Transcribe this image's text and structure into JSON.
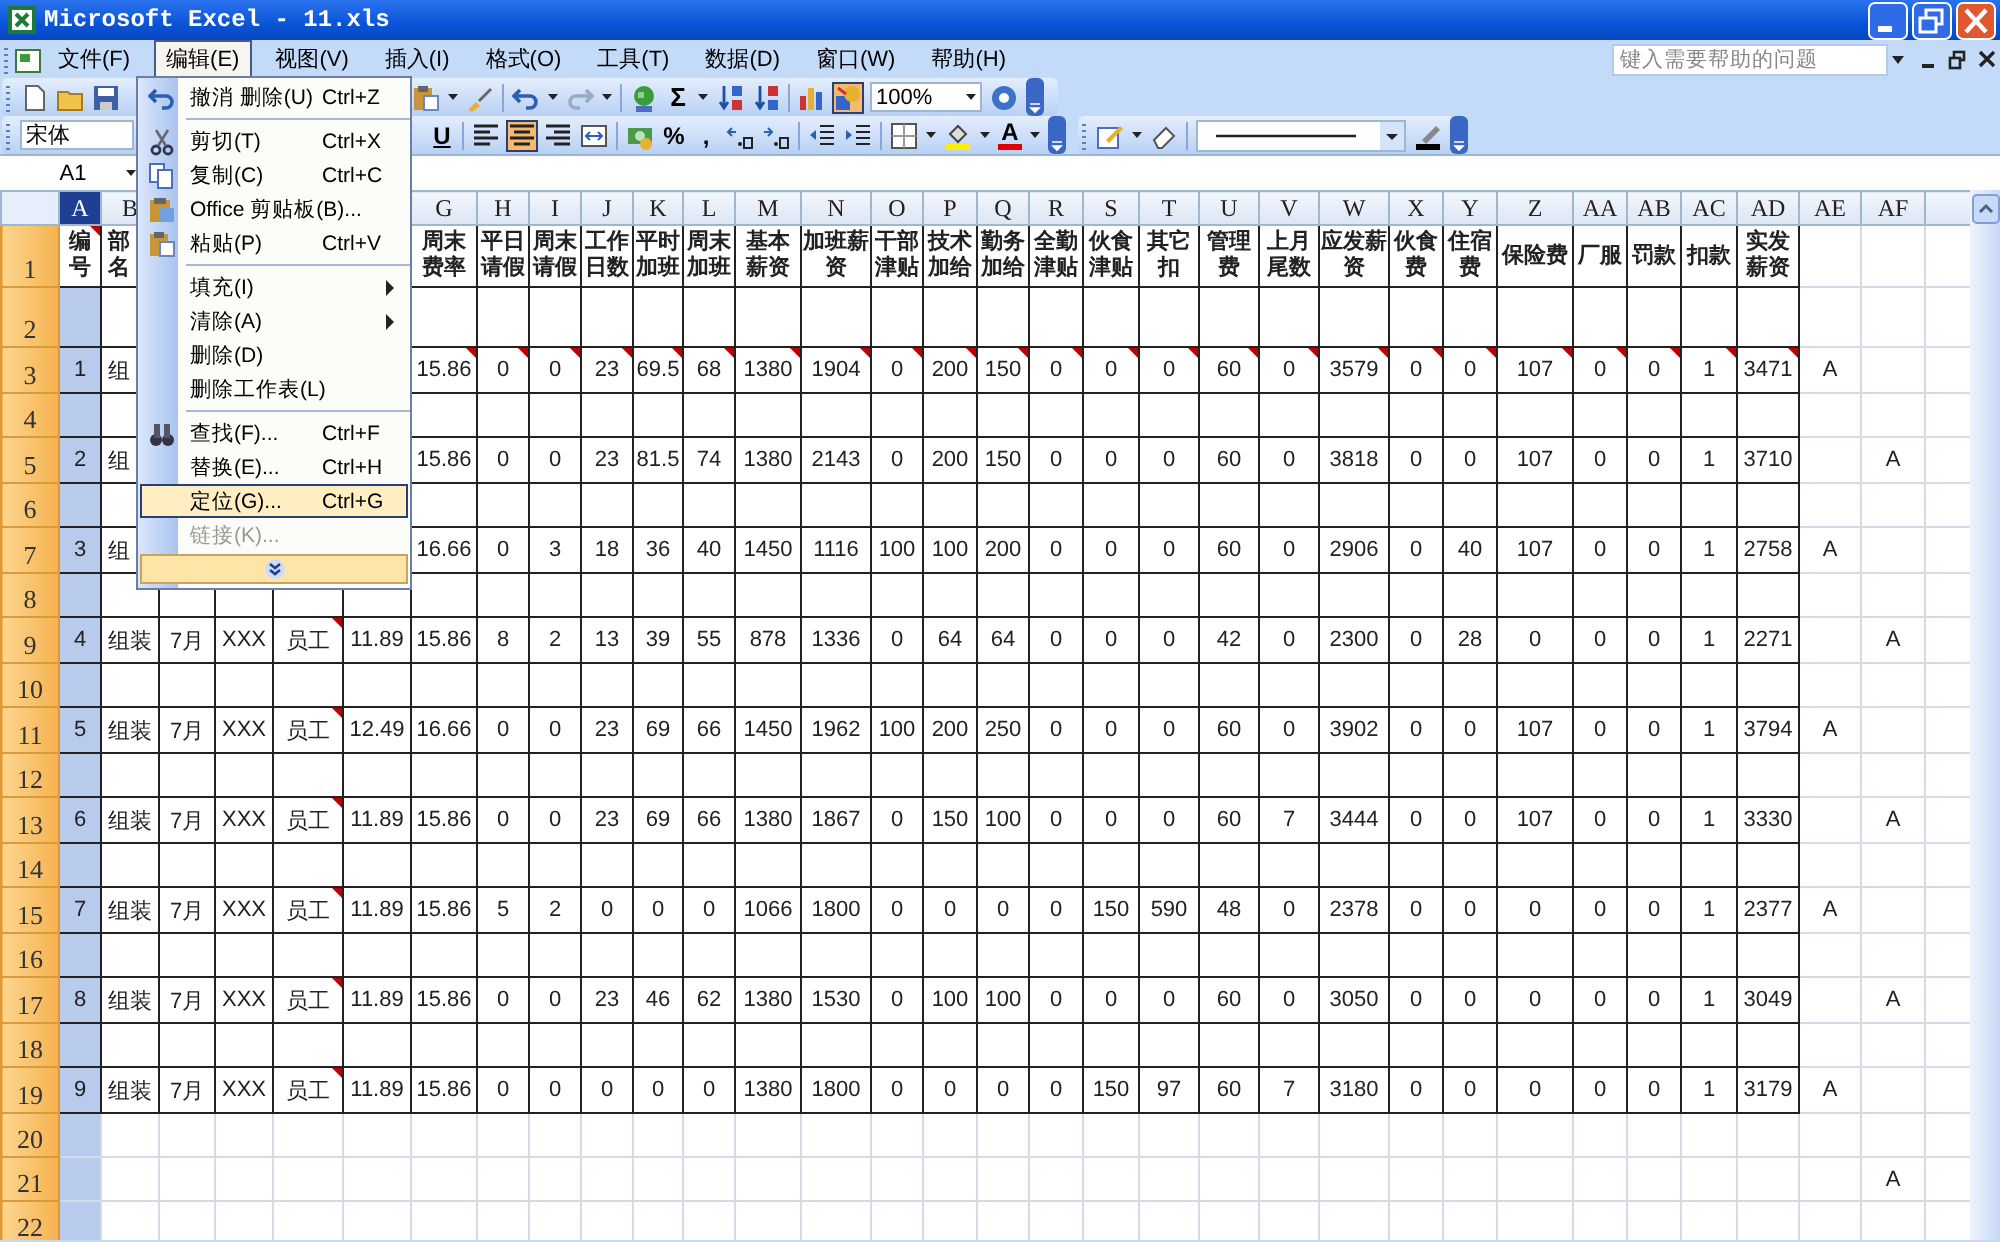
{
  "window": {
    "title": "Microsoft Excel - 11.xls"
  },
  "menu_bar": {
    "items": [
      {
        "label": "文件(F)",
        "selected": false
      },
      {
        "label": "编辑(E)",
        "selected": true
      },
      {
        "label": "视图(V)",
        "selected": false
      },
      {
        "label": "插入(I)",
        "selected": false
      },
      {
        "label": "格式(O)",
        "selected": false
      },
      {
        "label": "工具(T)",
        "selected": false
      },
      {
        "label": "数据(D)",
        "selected": false
      },
      {
        "label": "窗口(W)",
        "selected": false
      },
      {
        "label": "帮助(H)",
        "selected": false
      }
    ],
    "help_field": {
      "placeholder": "键入需要帮助的问题"
    }
  },
  "standard_toolbar": {
    "sum_symbol": "Σ",
    "zoom": "100%"
  },
  "formatting_toolbar": {
    "font": "宋体",
    "underline": "U",
    "percent": "%",
    "comma": ",",
    "font_color_letter": "A"
  },
  "formula_bar": {
    "name_box": "A1"
  },
  "edit_menu": {
    "items": [
      {
        "kind": "item",
        "label": "撤消 删除(U)",
        "shortcut": "Ctrl+Z",
        "selected": false,
        "disabled": false
      },
      {
        "kind": "separator"
      },
      {
        "kind": "item",
        "label": "剪切(T)",
        "shortcut": "Ctrl+X",
        "selected": false,
        "disabled": false
      },
      {
        "kind": "item",
        "label": "复制(C)",
        "shortcut": "Ctrl+C",
        "selected": false,
        "disabled": false
      },
      {
        "kind": "item",
        "label": "Office 剪贴板(B)...",
        "selected": false,
        "disabled": false
      },
      {
        "kind": "item",
        "label": "粘贴(P)",
        "shortcut": "Ctrl+V",
        "selected": false,
        "disabled": false
      },
      {
        "kind": "separator"
      },
      {
        "kind": "submenu",
        "label": "填充(I)",
        "selected": false,
        "disabled": false
      },
      {
        "kind": "submenu",
        "label": "清除(A)",
        "selected": false,
        "disabled": false
      },
      {
        "kind": "item",
        "label": "删除(D)",
        "selected": false,
        "disabled": false
      },
      {
        "kind": "item",
        "label": "删除工作表(L)",
        "selected": false,
        "disabled": false
      },
      {
        "kind": "separator"
      },
      {
        "kind": "item",
        "label": "查找(F)...",
        "shortcut": "Ctrl+F",
        "selected": false,
        "disabled": false
      },
      {
        "kind": "item",
        "label": "替换(E)...",
        "shortcut": "Ctrl+H",
        "selected": false,
        "disabled": false
      },
      {
        "kind": "item",
        "label": "定位(G)...",
        "shortcut": "Ctrl+G",
        "selected": true,
        "disabled": false
      },
      {
        "kind": "item",
        "label": "链接(K)...",
        "selected": false,
        "disabled": true
      },
      {
        "kind": "expand"
      }
    ]
  },
  "grid": {
    "columns": [
      {
        "letter": "A",
        "selected": true
      },
      {
        "letter": "B",
        "selected": false
      },
      null,
      null,
      null,
      null,
      {
        "letter": "G",
        "selected": false
      },
      {
        "letter": "H",
        "selected": false
      },
      {
        "letter": "I",
        "selected": false
      },
      {
        "letter": "J",
        "selected": false
      },
      {
        "letter": "K",
        "selected": false
      },
      {
        "letter": "L",
        "selected": false
      },
      {
        "letter": "M",
        "selected": false
      },
      {
        "letter": "N",
        "selected": false
      },
      {
        "letter": "O",
        "selected": false
      },
      {
        "letter": "P",
        "selected": false
      },
      {
        "letter": "Q",
        "selected": false
      },
      {
        "letter": "R",
        "selected": false
      },
      {
        "letter": "S",
        "selected": false
      },
      {
        "letter": "T",
        "selected": false
      },
      {
        "letter": "U",
        "selected": false
      },
      {
        "letter": "V",
        "selected": false
      },
      {
        "letter": "W",
        "selected": false
      },
      {
        "letter": "X",
        "selected": false
      },
      {
        "letter": "Y",
        "selected": false
      },
      {
        "letter": "Z",
        "selected": false
      },
      {
        "letter": "AA",
        "selected": false
      },
      {
        "letter": "AB",
        "selected": false
      },
      {
        "letter": "AC",
        "selected": false
      },
      {
        "letter": "AD",
        "selected": false
      },
      {
        "letter": "AE",
        "selected": false
      },
      {
        "letter": "AF",
        "selected": false
      }
    ],
    "rows": [
      {
        "number": "1",
        "cells": [
          {
            "text": "编号",
            "comment": true
          },
          "部名",
          null,
          null,
          null,
          null,
          "周末费率",
          "平日请假",
          "周末请假",
          "工作日数",
          "平时加班",
          "周末加班",
          "基本薪资",
          "加班薪资",
          "干部津贴",
          "技术加给",
          "勤务加给",
          "全勤津贴",
          "伙食津贴",
          "其它扣",
          "管理费",
          "上月尾数",
          "应发薪资",
          "伙食费",
          "住宿费",
          "保险费",
          "厂服",
          "罚款",
          "扣款",
          "实发薪资"
        ]
      },
      {
        "number": "2",
        "cells": []
      },
      {
        "number": "3",
        "cells": [
          "1",
          "组",
          null,
          null,
          null,
          null,
          {
            "text": "15.86",
            "comment": true
          },
          {
            "text": "0",
            "comment": true
          },
          {
            "text": "0",
            "comment": true
          },
          {
            "text": "23",
            "comment": true
          },
          {
            "text": "69.5",
            "comment": true
          },
          {
            "text": "68",
            "comment": true
          },
          {
            "text": "1380",
            "comment": true
          },
          {
            "text": "1904",
            "comment": true
          },
          {
            "text": "0",
            "comment": true
          },
          {
            "text": "200",
            "comment": true
          },
          {
            "text": "150",
            "comment": true
          },
          {
            "text": "0",
            "comment": true
          },
          {
            "text": "0",
            "comment": true
          },
          {
            "text": "0",
            "comment": true
          },
          {
            "text": "60",
            "comment": true
          },
          {
            "text": "0",
            "comment": true
          },
          {
            "text": "3579",
            "comment": true
          },
          {
            "text": "0",
            "comment": true
          },
          {
            "text": "0",
            "comment": true
          },
          {
            "text": "107",
            "comment": true
          },
          {
            "text": "0",
            "comment": true
          },
          {
            "text": "0",
            "comment": true
          },
          {
            "text": "1",
            "comment": true
          },
          {
            "text": "3471",
            "comment": true
          },
          "A"
        ]
      },
      {
        "number": "4",
        "cells": []
      },
      {
        "number": "5",
        "cells": [
          "2",
          "组",
          null,
          null,
          null,
          null,
          "15.86",
          "0",
          "0",
          "23",
          "81.5",
          "74",
          "1380",
          "2143",
          "0",
          "200",
          "150",
          "0",
          "0",
          "0",
          "60",
          "0",
          "3818",
          "0",
          "0",
          "107",
          "0",
          "0",
          "1",
          "3710",
          null,
          "A"
        ]
      },
      {
        "number": "6",
        "cells": []
      },
      {
        "number": "7",
        "cells": [
          "3",
          "组",
          null,
          null,
          null,
          null,
          "16.66",
          "0",
          "3",
          "18",
          "36",
          "40",
          "1450",
          "1116",
          "100",
          "100",
          "200",
          "0",
          "0",
          "0",
          "60",
          "0",
          "2906",
          "0",
          "40",
          "107",
          "0",
          "0",
          "1",
          "2758",
          "A"
        ]
      },
      {
        "number": "8",
        "cells": []
      },
      {
        "number": "9",
        "cells": [
          "4",
          "组装",
          "7月",
          "XXX",
          {
            "text": "员工",
            "comment": true
          },
          "11.89",
          "15.86",
          "8",
          "2",
          "13",
          "39",
          "55",
          "878",
          "1336",
          "0",
          "64",
          "64",
          "0",
          "0",
          "0",
          "42",
          "0",
          "2300",
          "0",
          "28",
          "0",
          "0",
          "0",
          "1",
          "2271",
          null,
          "A"
        ]
      },
      {
        "number": "10",
        "cells": []
      },
      {
        "number": "11",
        "cells": [
          "5",
          "组装",
          "7月",
          "XXX",
          {
            "text": "员工",
            "comment": true
          },
          "12.49",
          "16.66",
          "0",
          "0",
          "23",
          "69",
          "66",
          "1450",
          "1962",
          "100",
          "200",
          "250",
          "0",
          "0",
          "0",
          "60",
          "0",
          "3902",
          "0",
          "0",
          "107",
          "0",
          "0",
          "1",
          "3794",
          "A"
        ]
      },
      {
        "number": "12",
        "cells": []
      },
      {
        "number": "13",
        "cells": [
          "6",
          "组装",
          "7月",
          "XXX",
          {
            "text": "员工",
            "comment": true
          },
          "11.89",
          "15.86",
          "0",
          "0",
          "23",
          "69",
          "66",
          "1380",
          "1867",
          "0",
          "150",
          "100",
          "0",
          "0",
          "0",
          "60",
          "7",
          "3444",
          "0",
          "0",
          "107",
          "0",
          "0",
          "1",
          "3330",
          null,
          "A"
        ]
      },
      {
        "number": "14",
        "cells": []
      },
      {
        "number": "15",
        "cells": [
          "7",
          "组装",
          "7月",
          "XXX",
          {
            "text": "员工",
            "comment": true
          },
          "11.89",
          "15.86",
          "5",
          "2",
          "0",
          "0",
          "0",
          "1066",
          "1800",
          "0",
          "0",
          "0",
          "0",
          "150",
          "590",
          "48",
          "0",
          "2378",
          "0",
          "0",
          "0",
          "0",
          "0",
          "1",
          "2377",
          "A"
        ]
      },
      {
        "number": "16",
        "cells": []
      },
      {
        "number": "17",
        "cells": [
          "8",
          "组装",
          "7月",
          "XXX",
          {
            "text": "员工",
            "comment": true
          },
          "11.89",
          "15.86",
          "0",
          "0",
          "23",
          "46",
          "62",
          "1380",
          "1530",
          "0",
          "100",
          "100",
          "0",
          "0",
          "0",
          "60",
          "0",
          "3050",
          "0",
          "0",
          "0",
          "0",
          "0",
          "1",
          "3049",
          null,
          "A"
        ]
      },
      {
        "number": "18",
        "cells": []
      },
      {
        "number": "19",
        "cells": [
          "9",
          "组装",
          "7月",
          "XXX",
          {
            "text": "员工",
            "comment": true
          },
          "11.89",
          "15.86",
          "0",
          "0",
          "0",
          "0",
          "0",
          "1380",
          "1800",
          "0",
          "0",
          "0",
          "0",
          "150",
          "97",
          "60",
          "7",
          "3180",
          "0",
          "0",
          "0",
          "0",
          "0",
          "1",
          "3179",
          "A"
        ]
      },
      {
        "number": "20",
        "cells": []
      },
      {
        "number": "21",
        "cells": [
          null,
          null,
          null,
          null,
          null,
          null,
          null,
          null,
          null,
          null,
          null,
          null,
          null,
          null,
          null,
          null,
          null,
          null,
          null,
          null,
          null,
          null,
          null,
          null,
          null,
          null,
          null,
          null,
          null,
          null,
          null,
          "A"
        ]
      },
      {
        "number": "22",
        "cells": []
      }
    ]
  }
}
